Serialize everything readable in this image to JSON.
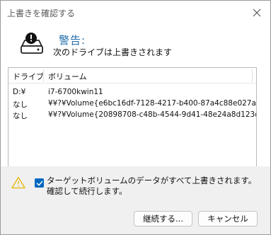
{
  "window": {
    "title": "上書きを確認する"
  },
  "header": {
    "warning_title": "警告:",
    "warning_message": "次のドライブは上書きされます"
  },
  "drive_list": {
    "columns": [
      "ドライブ",
      "ボリューム"
    ],
    "rows": [
      {
        "drive": "D:¥",
        "volume": "i7-6700kwin11"
      },
      {
        "drive": "なし",
        "volume": "¥¥?¥Volume{e6bc16df-7128-4217-b400-87a4c88e027a}¥"
      },
      {
        "drive": "なし",
        "volume": "¥¥?¥Volume{20898708-c48b-4544-9d41-48e24a8d123c}¥"
      }
    ]
  },
  "confirmation": {
    "checked": true,
    "label": "ターゲットボリュームのデータがすべて上書きされます。確認して続行します。"
  },
  "buttons": {
    "continue_label": "継続する...",
    "cancel_label": "キャンセル"
  },
  "icons": {
    "close": "close-icon",
    "drive": "drive-warning-icon",
    "alert": "warning-triangle-icon",
    "check": "check-icon"
  },
  "colors": {
    "accent": "#0067c0",
    "warning_title": "#1e6aa8",
    "warning_triangle": "#e8b400"
  }
}
